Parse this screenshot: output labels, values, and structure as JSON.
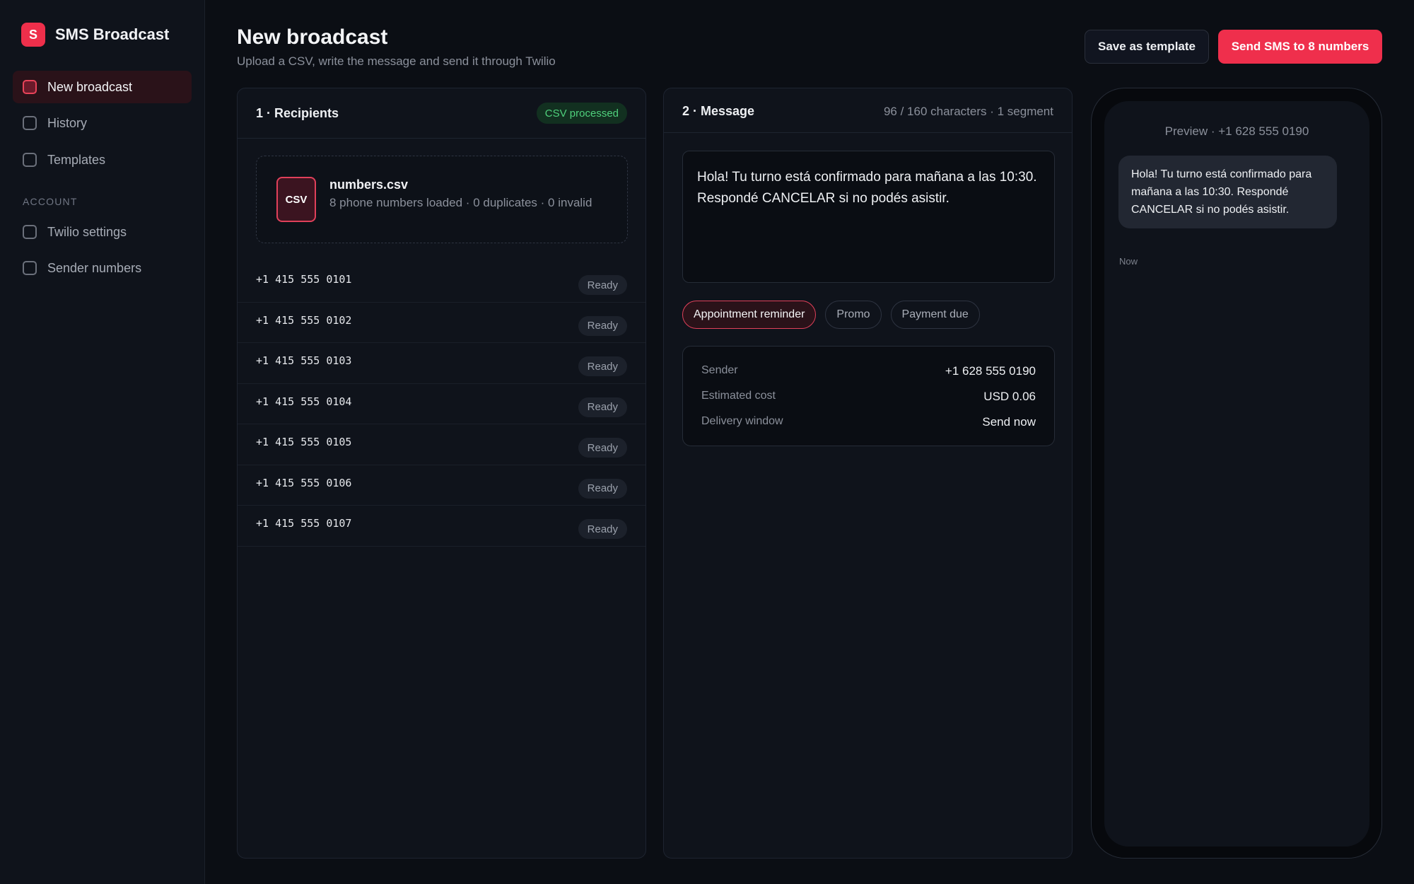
{
  "app": {
    "logo_letter": "S",
    "name": "SMS Broadcast"
  },
  "sidebar": {
    "items": [
      {
        "label": "New broadcast"
      },
      {
        "label": "History"
      },
      {
        "label": "Templates"
      }
    ],
    "account_section": "ACCOUNT",
    "account_items": [
      {
        "label": "Twilio settings"
      },
      {
        "label": "Sender numbers"
      }
    ]
  },
  "header": {
    "title": "New broadcast",
    "subtitle": "Upload a CSV, write the message and send it through Twilio",
    "save_template_label": "Save as template",
    "send_label": "Send SMS to 8 numbers"
  },
  "recipients": {
    "title": "1 · Recipients",
    "status_badge": "CSV processed",
    "file": {
      "icon_label": "CSV",
      "name": "numbers.csv",
      "meta": "8 phone numbers loaded · 0 duplicates · 0 invalid"
    },
    "rows": [
      {
        "number": "+1 415 555 0101",
        "status": "Ready"
      },
      {
        "number": "+1 415 555 0102",
        "status": "Ready"
      },
      {
        "number": "+1 415 555 0103",
        "status": "Ready"
      },
      {
        "number": "+1 415 555 0104",
        "status": "Ready"
      },
      {
        "number": "+1 415 555 0105",
        "status": "Ready"
      },
      {
        "number": "+1 415 555 0106",
        "status": "Ready"
      },
      {
        "number": "+1 415 555 0107",
        "status": "Ready"
      }
    ]
  },
  "message": {
    "title": "2 · Message",
    "char_count": "96 / 160 characters · 1 segment",
    "body": "Hola! Tu turno está confirmado para mañana a las 10:30. Respondé CANCELAR si no podés asistir.",
    "templates": [
      {
        "label": "Appointment reminder",
        "active": true
      },
      {
        "label": "Promo",
        "active": false
      },
      {
        "label": "Payment due",
        "active": false
      }
    ],
    "details": {
      "sender_label": "Sender",
      "sender_value": "+1 628 555 0190",
      "cost_label": "Estimated cost",
      "cost_value": "USD 0.06",
      "window_label": "Delivery window",
      "window_value": "Send now"
    }
  },
  "preview": {
    "header": "Preview · +1 628 555 0190",
    "bubble_text": "Hola! Tu turno está confirmado para mañana a las 10:30. Respondé CANCELAR si no podés asistir.",
    "time": "Now"
  },
  "colors": {
    "accent": "#ef2f4c",
    "background": "#0b0e14",
    "panel": "#0f131b",
    "success": "#4fd07c"
  }
}
